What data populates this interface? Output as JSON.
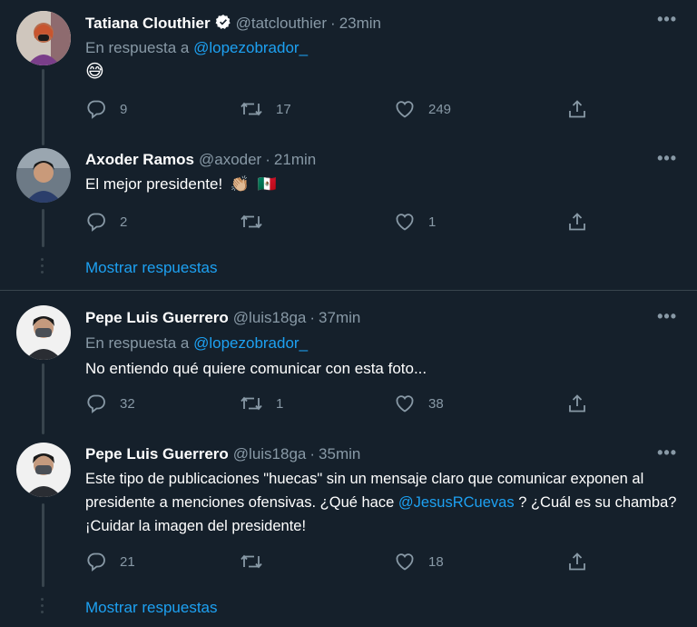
{
  "thread1": {
    "tweet1": {
      "name": "Tatiana Clouthier",
      "handle": "@tatclouthier",
      "time": "23min",
      "reply_prefix": "En respuesta a",
      "reply_handle": "@lopezobrador_",
      "text": "😅",
      "replies": "9",
      "retweets": "17",
      "likes": "249"
    },
    "tweet2": {
      "name": "Axoder Ramos",
      "handle": "@axoder",
      "time": "21min",
      "text": "El mejor presidente!",
      "emoji_clap": "👏🏼",
      "emoji_flag": "🇲🇽",
      "replies": "2",
      "retweets": "",
      "likes": "1"
    },
    "show_more": "Mostrar respuestas"
  },
  "thread2": {
    "tweet1": {
      "name": "Pepe Luis Guerrero",
      "handle": "@luis18ga",
      "time": "37min",
      "reply_prefix": "En respuesta a",
      "reply_handle": "@lopezobrador_",
      "text": "No entiendo qué quiere comunicar con esta foto...",
      "replies": "32",
      "retweets": "1",
      "likes": "38"
    },
    "tweet2": {
      "name": "Pepe Luis Guerrero",
      "handle": "@luis18ga",
      "time": "35min",
      "text_part1": "Este tipo de publicaciones \"huecas\" sin un mensaje claro que comunicar exponen al presidente a menciones ofensivas. ¿Qué hace",
      "mention": "@JesusRCuevas",
      "text_part2": "? ¿Cuál es su chamba? ¡Cuidar la imagen del presidente!",
      "replies": "21",
      "retweets": "",
      "likes": "18"
    },
    "show_more": "Mostrar respuestas"
  },
  "dot_separator": "·",
  "colors": {
    "background": "#15202b",
    "secondary_text": "#8899a6",
    "link": "#1da1f2",
    "divider": "#38444d"
  }
}
